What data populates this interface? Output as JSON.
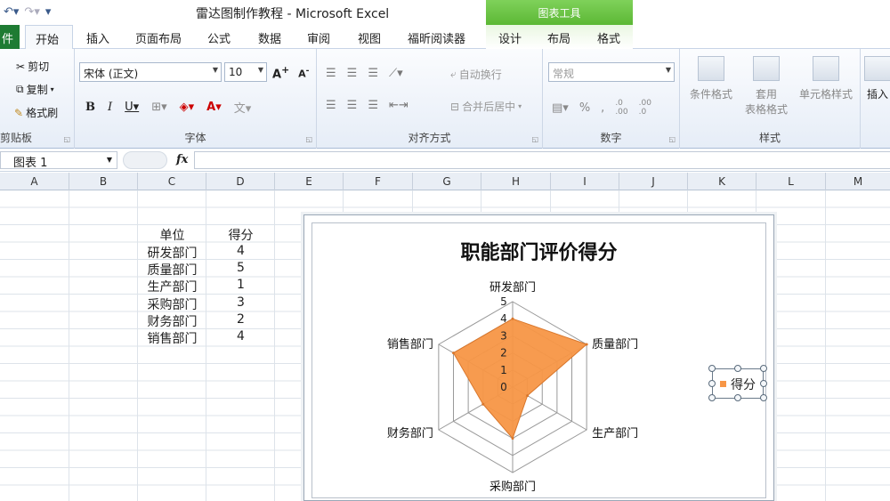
{
  "window": {
    "title": "雷达图制作教程 - Microsoft Excel",
    "chart_tools_label": "图表工具"
  },
  "tabs": [
    {
      "label": "件"
    },
    {
      "label": "开始"
    },
    {
      "label": "插入"
    },
    {
      "label": "页面布局"
    },
    {
      "label": "公式"
    },
    {
      "label": "数据"
    },
    {
      "label": "审阅"
    },
    {
      "label": "视图"
    },
    {
      "label": "福昕阅读器"
    },
    {
      "label": "设计"
    },
    {
      "label": "布局"
    },
    {
      "label": "格式"
    }
  ],
  "ribbon": {
    "clipboard": {
      "label": "剪贴板",
      "cut": "剪切",
      "copy": "复制",
      "painter": "格式刷"
    },
    "font": {
      "label": "字体",
      "name": "宋体 (正文)",
      "size": "10"
    },
    "alignment": {
      "label": "对齐方式",
      "wrap": "自动换行",
      "merge": "合并后居中"
    },
    "number": {
      "label": "数字",
      "format": "常规"
    },
    "styles": {
      "label": "样式",
      "conditional": "条件格式",
      "table_1": "套用",
      "table_2": "表格格式",
      "cell_styles": "单元格样式"
    },
    "cells": {
      "insert": "插入"
    }
  },
  "formula_bar": {
    "name_box": "图表 1",
    "fx": "fx",
    "formula": ""
  },
  "columns": [
    "A",
    "B",
    "C",
    "D",
    "E",
    "F",
    "G",
    "H",
    "I",
    "J",
    "K",
    "L",
    "M"
  ],
  "table": {
    "header": [
      "单位",
      "得分"
    ],
    "rows": [
      [
        "研发部门",
        "4"
      ],
      [
        "质量部门",
        "5"
      ],
      [
        "生产部门",
        "1"
      ],
      [
        "采购部门",
        "3"
      ],
      [
        "财务部门",
        "2"
      ],
      [
        "销售部门",
        "4"
      ]
    ]
  },
  "chart_data": {
    "type": "radar",
    "title": "职能部门评价得分",
    "categories": [
      "研发部门",
      "质量部门",
      "生产部门",
      "采购部门",
      "财务部门",
      "销售部门"
    ],
    "series": [
      {
        "name": "得分",
        "values": [
          4,
          5,
          1,
          3,
          2,
          4
        ],
        "color": "#f79646"
      }
    ],
    "rlim": [
      0,
      5
    ],
    "ticks": [
      "0",
      "1",
      "2",
      "3",
      "4",
      "5"
    ],
    "legend_position": "right"
  }
}
